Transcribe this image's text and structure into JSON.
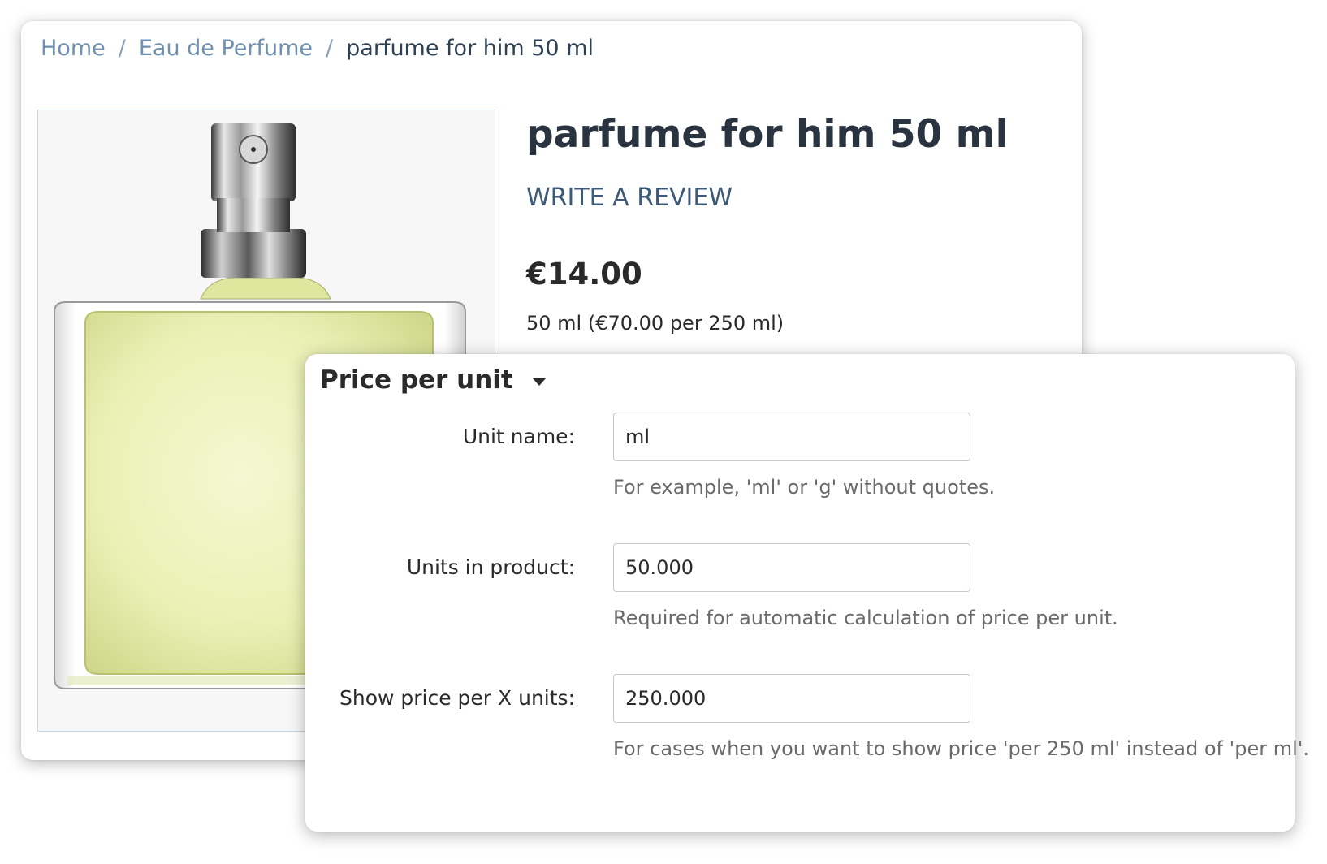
{
  "breadcrumb": {
    "items": [
      {
        "label": "Home"
      },
      {
        "label": "Eau de Perfume"
      },
      {
        "label": "parfume for him 50 ml"
      }
    ],
    "separator": "/"
  },
  "product": {
    "title": "parfume for him 50 ml",
    "write_review": "WRITE A REVIEW",
    "price": "€14.00",
    "unit_price_text": "50 ml (€70.00 per 250 ml)",
    "image_icon": "perfume-bottle-image"
  },
  "price_per_unit_panel": {
    "title": "Price per unit",
    "toggle_icon": "caret-down-icon",
    "fields": [
      {
        "label": "Unit name:",
        "value": "ml",
        "hint": "For example, 'ml' or 'g' without quotes."
      },
      {
        "label": "Units in product:",
        "value": "50.000",
        "hint": "Required for automatic calculation of price per unit."
      },
      {
        "label": "Show price per X units:",
        "value": "250.000",
        "hint": "For cases when you want to show price 'per 250 ml' instead of 'per ml'."
      }
    ]
  },
  "colors": {
    "breadcrumb_link": "#6f90b0",
    "review_link": "#3d5a78",
    "title": "#2a3440",
    "liquid": "#e8efb0"
  }
}
